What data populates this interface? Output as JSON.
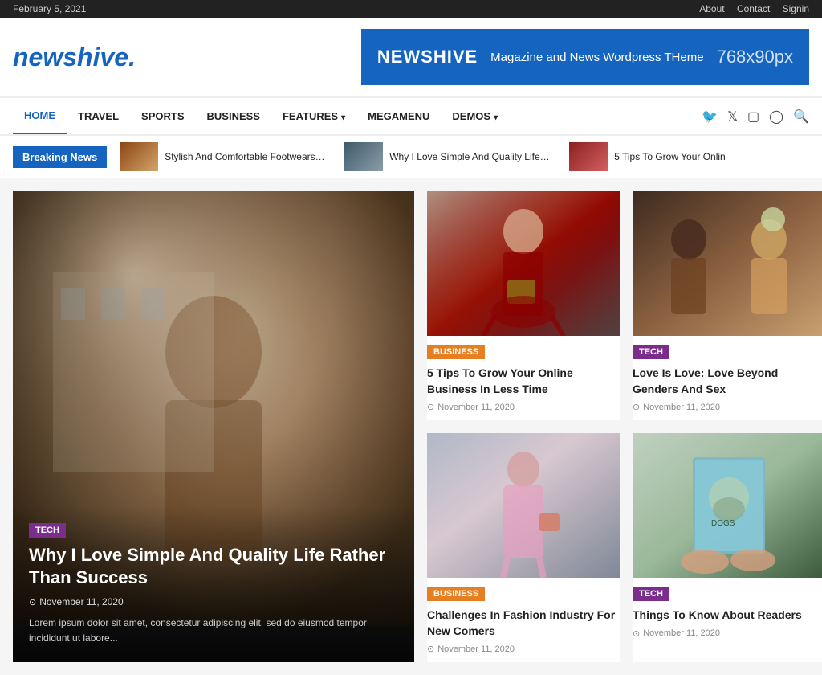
{
  "topbar": {
    "date": "February 5, 2021",
    "links": [
      "About",
      "Contact",
      "Signin"
    ]
  },
  "header": {
    "logo_part1": "news",
    "logo_part2": "hive",
    "logo_dot": ".",
    "ad": {
      "brand": "NEWSHIVE",
      "text": "Magazine and News Wordpress THeme",
      "size": "768x90px"
    }
  },
  "nav": {
    "items": [
      {
        "label": "HOME",
        "active": true
      },
      {
        "label": "TRAVEL",
        "active": false
      },
      {
        "label": "SPORTS",
        "active": false
      },
      {
        "label": "BUSINESS",
        "active": false
      },
      {
        "label": "FEATURES",
        "has_dropdown": true,
        "active": false
      },
      {
        "label": "MEGAMENU",
        "active": false
      },
      {
        "label": "DEMOS",
        "has_dropdown": true,
        "active": false
      }
    ]
  },
  "breaking_news": {
    "label": "Breaking News",
    "items": [
      {
        "title": "Stylish And Comfortable Footwears At Best Price"
      },
      {
        "title": "Why I Love Simple And Quality Life Rather Than Success"
      },
      {
        "title": "5 Tips To Grow Your Onlin"
      }
    ]
  },
  "featured": {
    "category": "TECH",
    "category_class": "badge-tech",
    "title": "Why I Love Simple And Quality Life Rather Than Success",
    "date": "November 11, 2020",
    "excerpt": "Lorem ipsum dolor sit amet, consectetur adipiscing elit, sed do eiusmod tempor incididunt ut labore..."
  },
  "articles": [
    {
      "category": "BUSINESS",
      "category_class": "badge-business",
      "title": "5 Tips To Grow Your Online Business In Less Time",
      "date": "November 11, 2020",
      "img_class": "img-fashion1"
    },
    {
      "category": "TECH",
      "category_class": "badge-tech",
      "title": "Love Is Love: Love Beyond Genders And Sex",
      "date": "November 11, 2020",
      "img_class": "img-people1"
    },
    {
      "category": "BUSINESS",
      "category_class": "badge-business",
      "title": "Challenges In Fashion Industry For New Comers",
      "date": "November 11, 2020",
      "img_class": "img-fashion2"
    },
    {
      "category": "TECH",
      "category_class": "badge-tech",
      "title": "Things To Know About Readers",
      "date": "November 11, 2020",
      "img_class": "img-book"
    }
  ]
}
